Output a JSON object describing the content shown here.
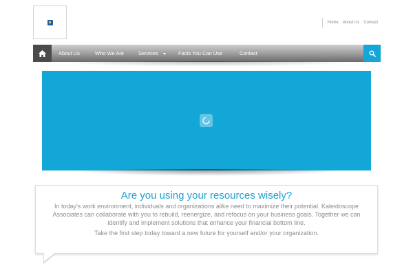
{
  "top_links": [
    "Home",
    "About Us",
    "Contact"
  ],
  "nav": {
    "items": [
      {
        "label": "About Us"
      },
      {
        "label": "Who We Are"
      },
      {
        "label": "Services"
      },
      {
        "label": "Facts You Can Use"
      },
      {
        "label": "Contact"
      }
    ]
  },
  "callout": {
    "heading": "Are you using your resources wisely?",
    "paragraph1": "In today's work environment, individuals and organizations alike need to maximize their potential. Kaleidoscope Associates can collaborate with you to rebuild, reenergize, and refocus on your business goals. Together we can identify and implement solutions that enhance your financial bottom line.",
    "paragraph2": "Take the first step today toward a new future for yourself and/or your organization."
  },
  "icons": {
    "home": "home-icon",
    "search": "search-icon",
    "loader": "loading-spinner-icon",
    "dropdown": "chevron-down-icon"
  },
  "colors": {
    "accent": "#12a7d7",
    "nav_home": "#4b4b4b",
    "text": "#8c8c8c"
  }
}
